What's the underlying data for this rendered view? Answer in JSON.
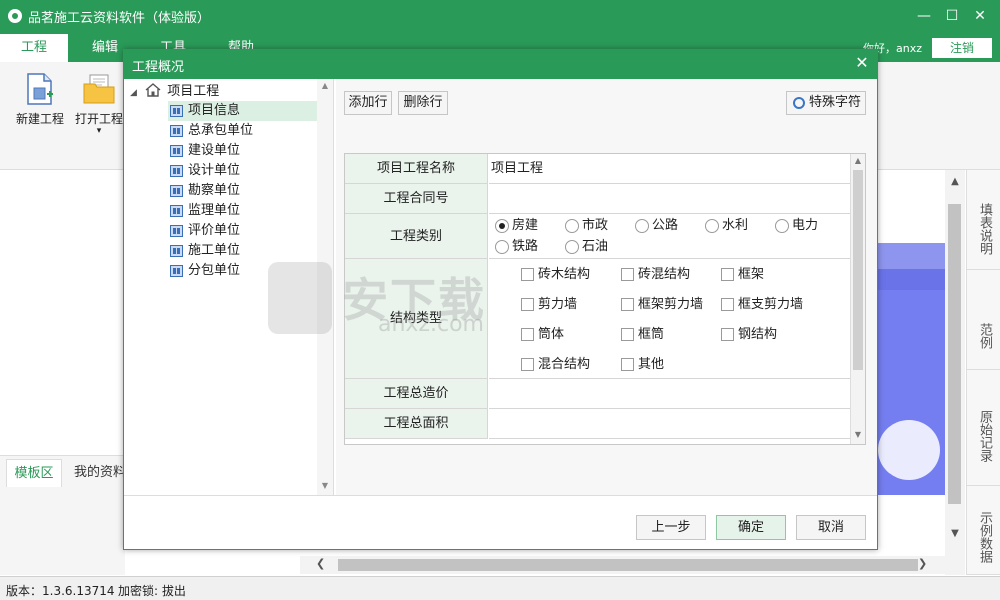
{
  "app": {
    "title": "品茗施工云资料软件（体验版）",
    "win_min": "—",
    "win_max": "☐",
    "win_close": "✕"
  },
  "menu": {
    "tabs": [
      "工程",
      "编辑",
      "工具",
      "帮助"
    ],
    "greeting": "你好，anxz",
    "logout": "注销"
  },
  "toolbar": {
    "new_project": "新建工程",
    "open_project": "打开工程",
    "open_arrow": "▾"
  },
  "side_tabs": [
    "填表说明",
    "范例",
    "原始记录",
    "示例数据"
  ],
  "bottom_tabs": {
    "template": "模板区",
    "my_docs": "我的资料"
  },
  "status": {
    "version": "版本：1.3.6.13714",
    "lock": "加密锁: 拔出"
  },
  "dialog": {
    "title": "工程概况",
    "close": "✕",
    "tree": {
      "root": "项目工程",
      "items": [
        "项目信息",
        "总承包单位",
        "建设单位",
        "设计单位",
        "勘察单位",
        "监理单位",
        "评价单位",
        "施工单位",
        "分包单位"
      ],
      "selected_index": 0
    },
    "buttons": {
      "add_row": "添加行",
      "delete_row": "删除行",
      "special_chars": "特殊字符"
    },
    "form": {
      "project_name_label": "项目工程名称",
      "project_name_value": "项目工程",
      "contract_no_label": "工程合同号",
      "contract_no_value": "",
      "type_label": "工程类别",
      "type_options": [
        "房建",
        "市政",
        "公路",
        "水利",
        "电力",
        "铁路",
        "石油"
      ],
      "type_selected": "房建",
      "structure_label": "结构类型",
      "structure_options": [
        "砖木结构",
        "砖混结构",
        "框架",
        "剪力墙",
        "框架剪力墙",
        "框支剪力墙",
        "筒体",
        "框筒",
        "钢结构",
        "混合结构",
        "其他"
      ],
      "total_cost_label": "工程总造价",
      "total_cost_value": "",
      "total_area_label": "工程总面积",
      "total_area_value": ""
    },
    "footer": {
      "prev": "上一步",
      "ok": "确定",
      "cancel": "取消"
    },
    "watermark": {
      "main": "安下载",
      "sub": "anxz.com"
    }
  },
  "colors": {
    "brand_green": "#2a9a58",
    "label_bg": "#eaf3ec",
    "banner_purple": "#6a73e8"
  }
}
